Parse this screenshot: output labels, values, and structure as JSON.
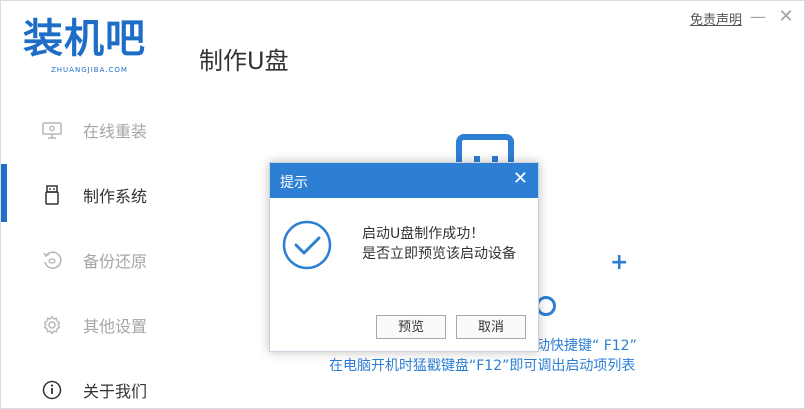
{
  "header": {
    "logo_text": "装机吧",
    "logo_sub": "ZHUANGJIBA.COM",
    "title": "制作U盘",
    "disclaimer": "免责声明",
    "minimize": "—",
    "close": "✕"
  },
  "sidebar": {
    "items": [
      {
        "label": "在线重装",
        "icon": "monitor-icon"
      },
      {
        "label": "制作系统",
        "icon": "usb-icon"
      },
      {
        "label": "备份还原",
        "icon": "restore-icon"
      },
      {
        "label": "其他设置",
        "icon": "gear-icon"
      },
      {
        "label": "关于我们",
        "icon": "info-icon"
      }
    ],
    "active_index": 1
  },
  "background": {
    "hint1": "动快捷键“ F12”",
    "hint2": "在电脑开机时猛戳键盘“F12”即可调出启动项列表",
    "plus": "+"
  },
  "dialog": {
    "title": "提示",
    "close": "✕",
    "message_line1": "启动U盘制作成功！",
    "message_line2": "是否立即预览该启动设备",
    "preview_button": "预览",
    "cancel_button": "取消",
    "icon": "check-circle-icon"
  },
  "colors": {
    "accent": "#2d7fd4",
    "brand": "#1e6ec8"
  }
}
